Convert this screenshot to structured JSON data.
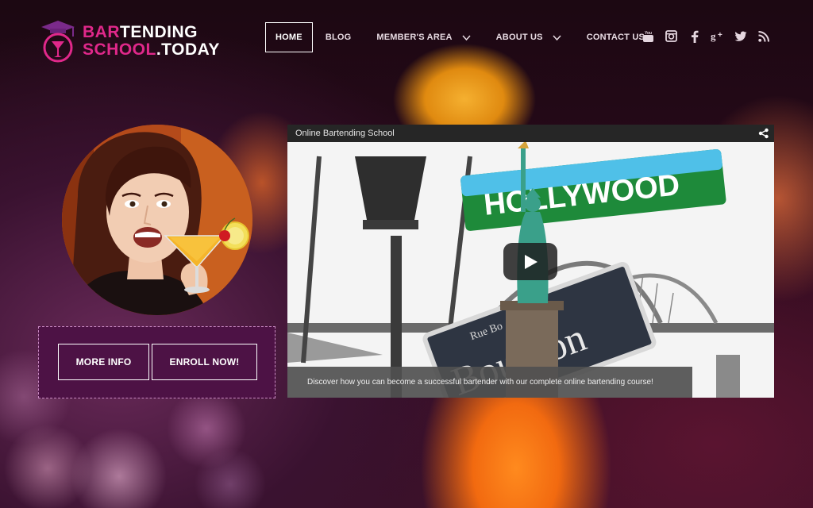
{
  "brand": {
    "line1_part1": "BAR",
    "line1_part2": "TENDING",
    "line2_part1": "SCHOOL",
    "line2_part2": ".TODAY",
    "colors": {
      "pink": "#e0288a",
      "purple": "#7a2a8a"
    }
  },
  "nav": {
    "items": [
      {
        "label": "HOME",
        "active": true
      },
      {
        "label": "BLOG"
      },
      {
        "label": "MEMBER'S AREA",
        "dropdown": true
      },
      {
        "label": "ABOUT US",
        "dropdown": true
      },
      {
        "label": "CONTACT US"
      }
    ]
  },
  "social": [
    "youtube-icon",
    "instagram-icon",
    "facebook-icon",
    "google-plus-icon",
    "twitter-icon",
    "rss-icon"
  ],
  "cta": {
    "more_info": "MORE INFO",
    "enroll": "ENROLL NOW!"
  },
  "video": {
    "title": "Online Bartending School",
    "caption": "Discover how you can become a successful bartender with our complete online bartending course!",
    "sign_top": "HOLLYWOOD",
    "sign_small": "Rue Bo",
    "sign_mid": "Bourbon"
  }
}
